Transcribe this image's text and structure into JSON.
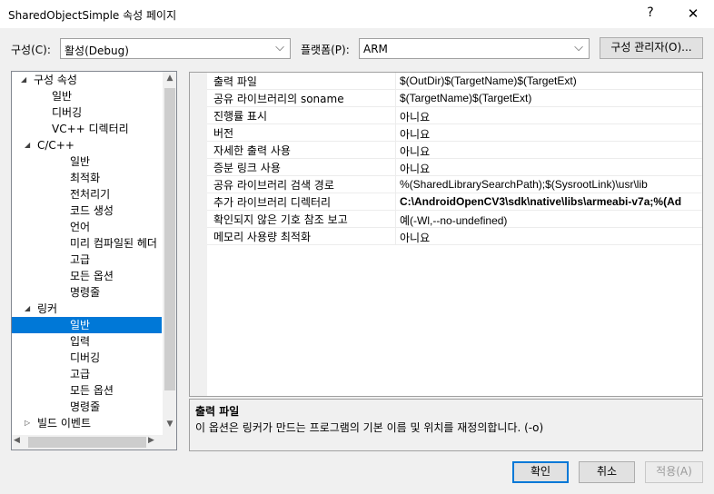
{
  "window": {
    "title": "SharedObjectSimple 속성 페이지",
    "help_glyph": "?",
    "close_glyph": "✕"
  },
  "config": {
    "configuration_label": "구성(C):",
    "configuration_value": "활성(Debug)",
    "platform_label": "플랫폼(P):",
    "platform_value": "ARM",
    "manager_button": "구성 관리자(O)..."
  },
  "tree": {
    "items": [
      {
        "label": "구성 속성",
        "expander": "◢"
      },
      {
        "label": "일반"
      },
      {
        "label": "디버깅"
      },
      {
        "label": "VC++ 디렉터리"
      },
      {
        "label": "C/C++",
        "expander": "◢"
      },
      {
        "label": "일반"
      },
      {
        "label": "최적화"
      },
      {
        "label": "전처리기"
      },
      {
        "label": "코드 생성"
      },
      {
        "label": "언어"
      },
      {
        "label": "미리 컴파일된 헤더"
      },
      {
        "label": "고급"
      },
      {
        "label": "모든 옵션"
      },
      {
        "label": "명령줄"
      },
      {
        "label": "링커",
        "expander": "◢"
      },
      {
        "label": "일반",
        "selected": true
      },
      {
        "label": "입력"
      },
      {
        "label": "디버깅"
      },
      {
        "label": "고급"
      },
      {
        "label": "모든 옵션"
      },
      {
        "label": "명령줄"
      },
      {
        "label": "빌드 이벤트",
        "expander": "▷"
      }
    ]
  },
  "properties": [
    {
      "name": "출력 파일",
      "value": "$(OutDir)$(TargetName)$(TargetExt)"
    },
    {
      "name": "공유 라이브러리의 soname",
      "value": "$(TargetName)$(TargetExt)"
    },
    {
      "name": "진행률 표시",
      "value": "아니요"
    },
    {
      "name": "버전",
      "value": "아니요"
    },
    {
      "name": "자세한 출력 사용",
      "value": "아니요"
    },
    {
      "name": "증분 링크 사용",
      "value": "아니요"
    },
    {
      "name": "공유 라이브러리 검색 경로",
      "value": "%(SharedLibrarySearchPath);$(SysrootLink)\\usr\\lib"
    },
    {
      "name": "추가 라이브러리 디렉터리",
      "value": "C:\\AndroidOpenCV3\\sdk\\native\\libs\\armeabi-v7a;%(Ad",
      "bold": true
    },
    {
      "name": "확인되지 않은 기호 참조 보고",
      "value": "예(-Wl,--no-undefined)"
    },
    {
      "name": "메모리 사용량 최적화",
      "value": "아니요"
    }
  ],
  "description": {
    "title": "출력 파일",
    "text": "이 옵션은 링커가 만드는 프로그램의 기본 이름 및 위치를 재정의합니다. (-o)"
  },
  "buttons": {
    "ok": "확인",
    "cancel": "취소",
    "apply": "적용(A)"
  }
}
